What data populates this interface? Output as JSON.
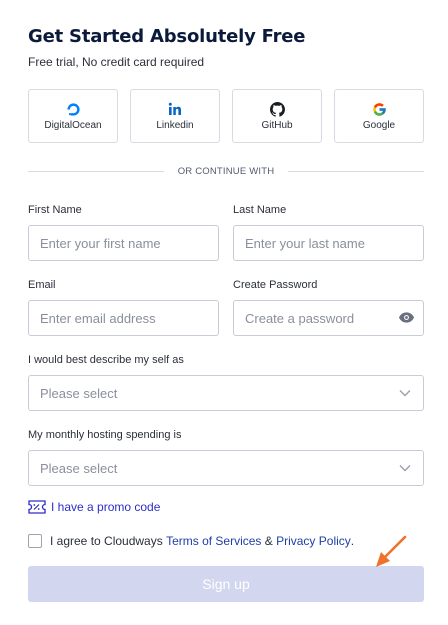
{
  "header": {
    "title": "Get Started Absolutely Free",
    "subtitle": "Free trial, No credit card required"
  },
  "providers": [
    {
      "label": "DigitalOcean",
      "icon": "digitalocean-icon",
      "color": "#0080ff"
    },
    {
      "label": "Linkedin",
      "icon": "linkedin-icon",
      "color": "#0a66c2"
    },
    {
      "label": "GitHub",
      "icon": "github-icon",
      "color": "#1b1f23"
    },
    {
      "label": "Google",
      "icon": "google-icon",
      "color": "#4285f4"
    }
  ],
  "divider": {
    "text": "OR CONTINUE WITH"
  },
  "form": {
    "first_name": {
      "label": "First Name",
      "placeholder": "Enter your first name",
      "value": ""
    },
    "last_name": {
      "label": "Last Name",
      "placeholder": "Enter your last name",
      "value": ""
    },
    "email": {
      "label": "Email",
      "placeholder": "Enter email address",
      "value": ""
    },
    "password": {
      "label": "Create Password",
      "placeholder": "Create a password",
      "value": ""
    },
    "describe": {
      "label": "I would best describe my self as",
      "selected": "Please select"
    },
    "spending": {
      "label": "My monthly hosting spending is",
      "selected": "Please select"
    }
  },
  "promo": {
    "text": "I have a promo code",
    "icon": "ticket-icon"
  },
  "agree": {
    "prefix": "I agree to Cloudways ",
    "terms": "Terms of Services",
    "amp": " & ",
    "privacy": "Privacy Policy",
    "suffix": ".",
    "checked": false
  },
  "signup": {
    "label": "Sign up"
  },
  "colors": {
    "accent": "#2d2dc8",
    "button_disabled": "#d3d6ef",
    "annotation_arrow": "#f0712c"
  }
}
